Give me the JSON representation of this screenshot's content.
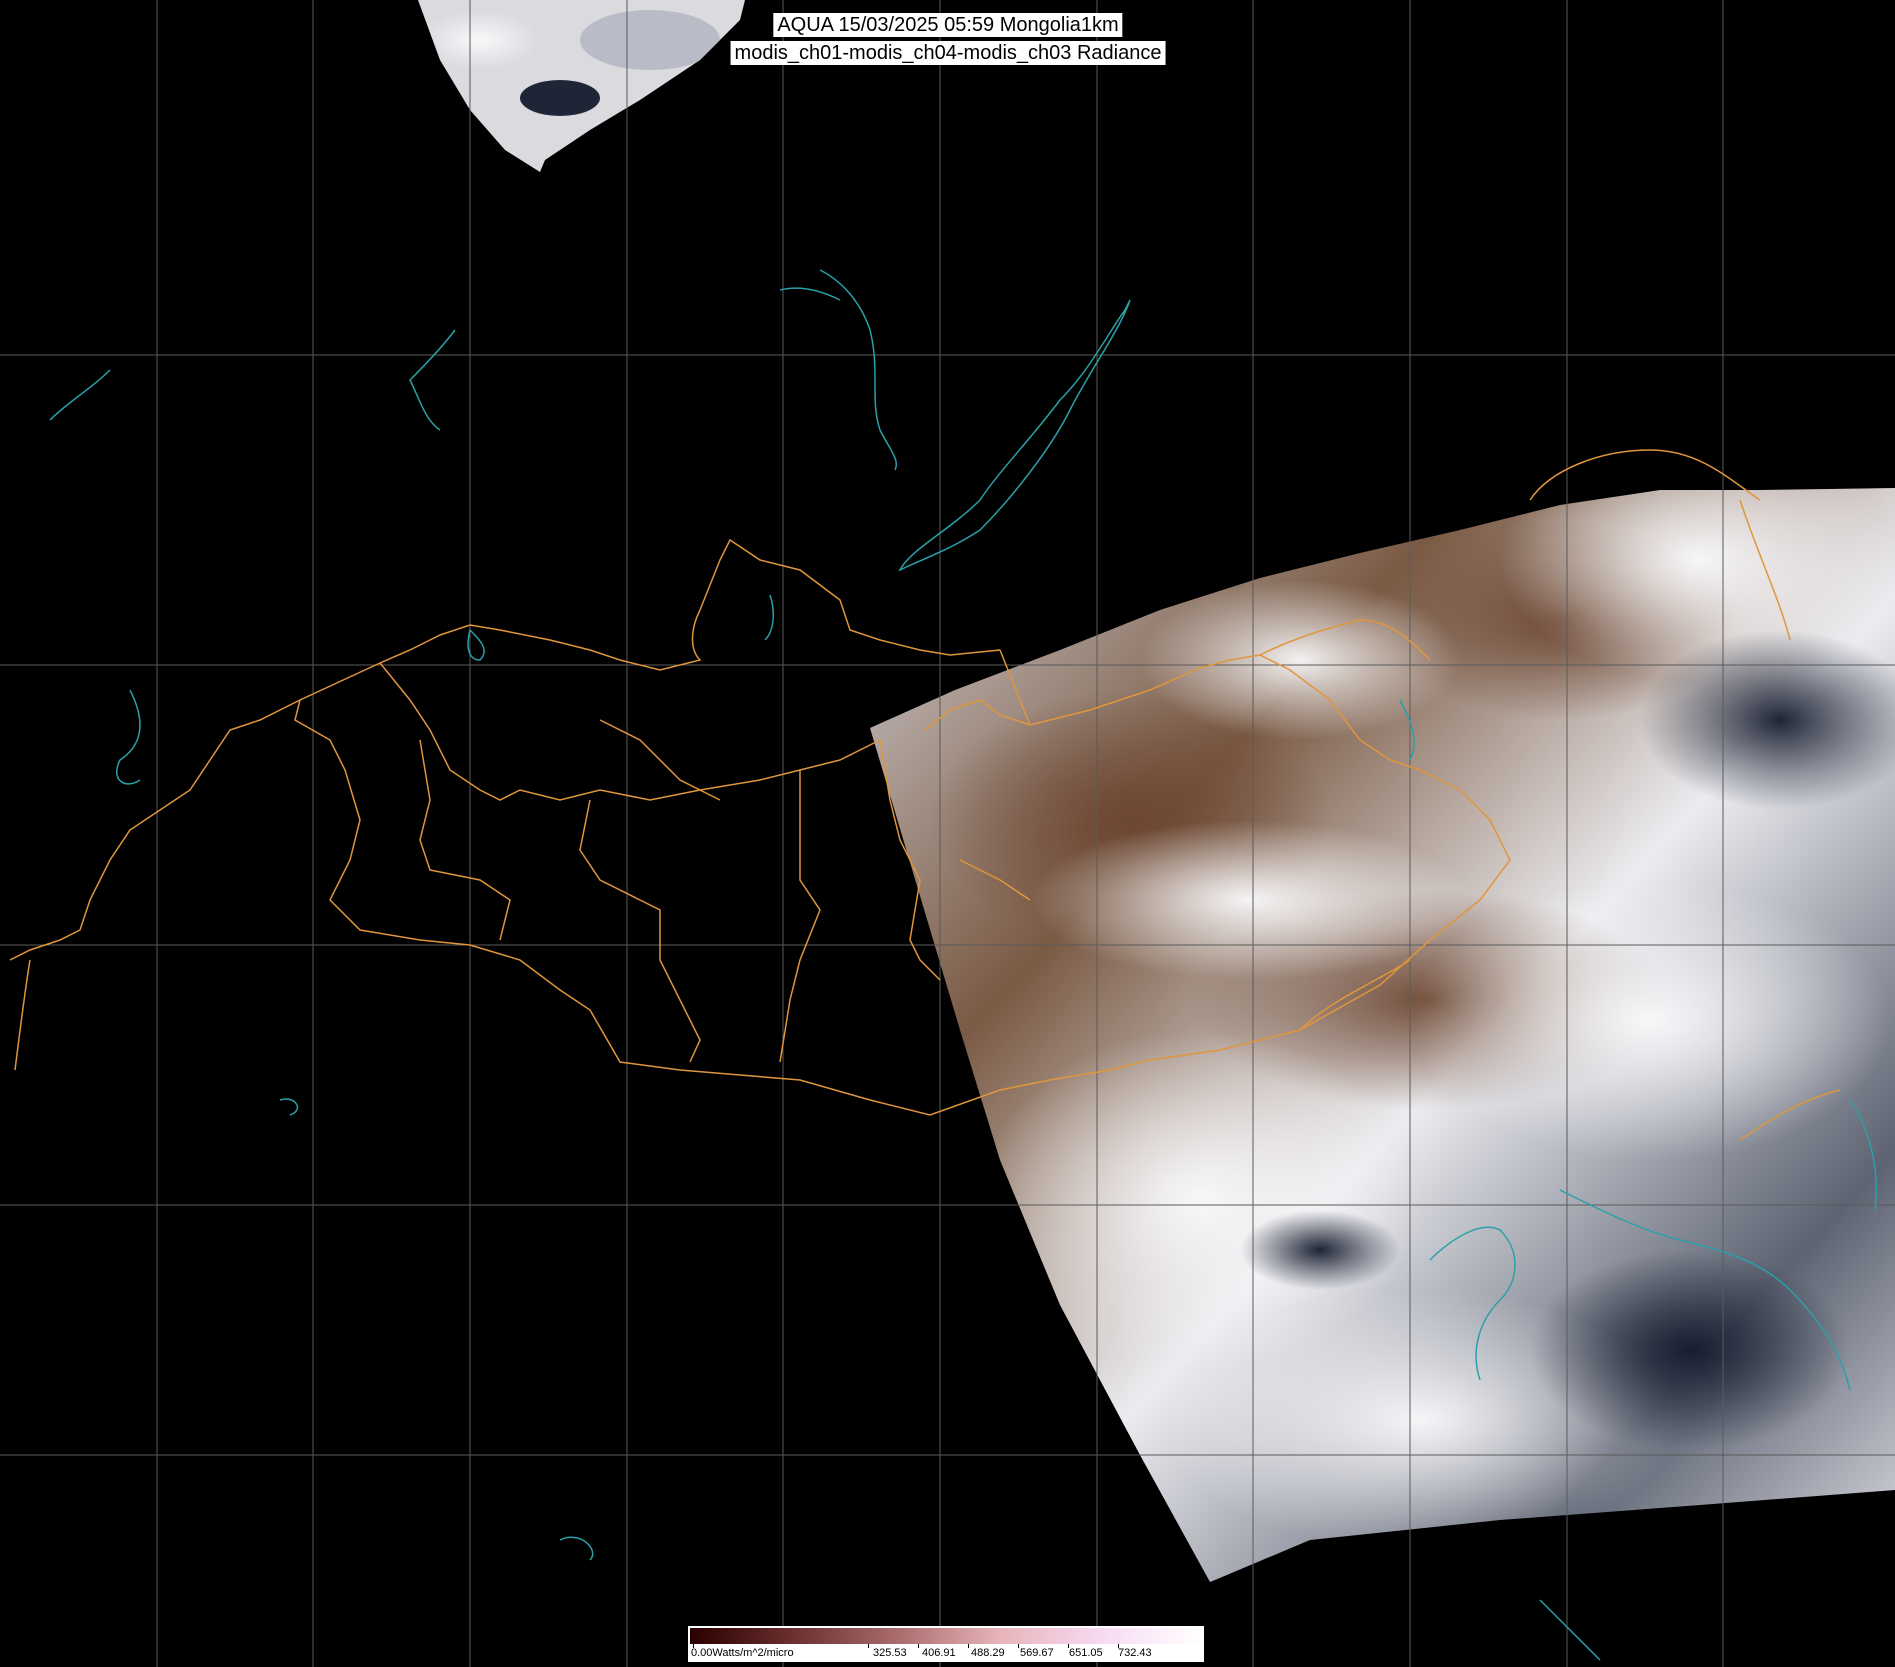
{
  "header": {
    "line1": "AQUA 15/03/2025 05:59 Mongolia1km",
    "line2": "modis_ch01-modis_ch04-modis_ch03 Radiance"
  },
  "colorbar": {
    "unit_label": "0.00Watts/m^2/micro",
    "ticks": [
      "325.53",
      "406.91",
      "488.29",
      "569.67",
      "651.05",
      "732.43"
    ],
    "gradient_colors": [
      "#2a0000",
      "#6b2f2f",
      "#a86a6a",
      "#e6b3b8",
      "#f7d9f2",
      "#ffffff"
    ]
  },
  "colors": {
    "background": "#000000",
    "graticule": "#5a5a5a",
    "coastline_water": "#2aa0a8",
    "borders": "#e0963c",
    "cloud": "#f0f0f4",
    "land_brown": "#6e4a34"
  },
  "map": {
    "satellite": "AQUA",
    "region": "Mongolia1km"
  }
}
